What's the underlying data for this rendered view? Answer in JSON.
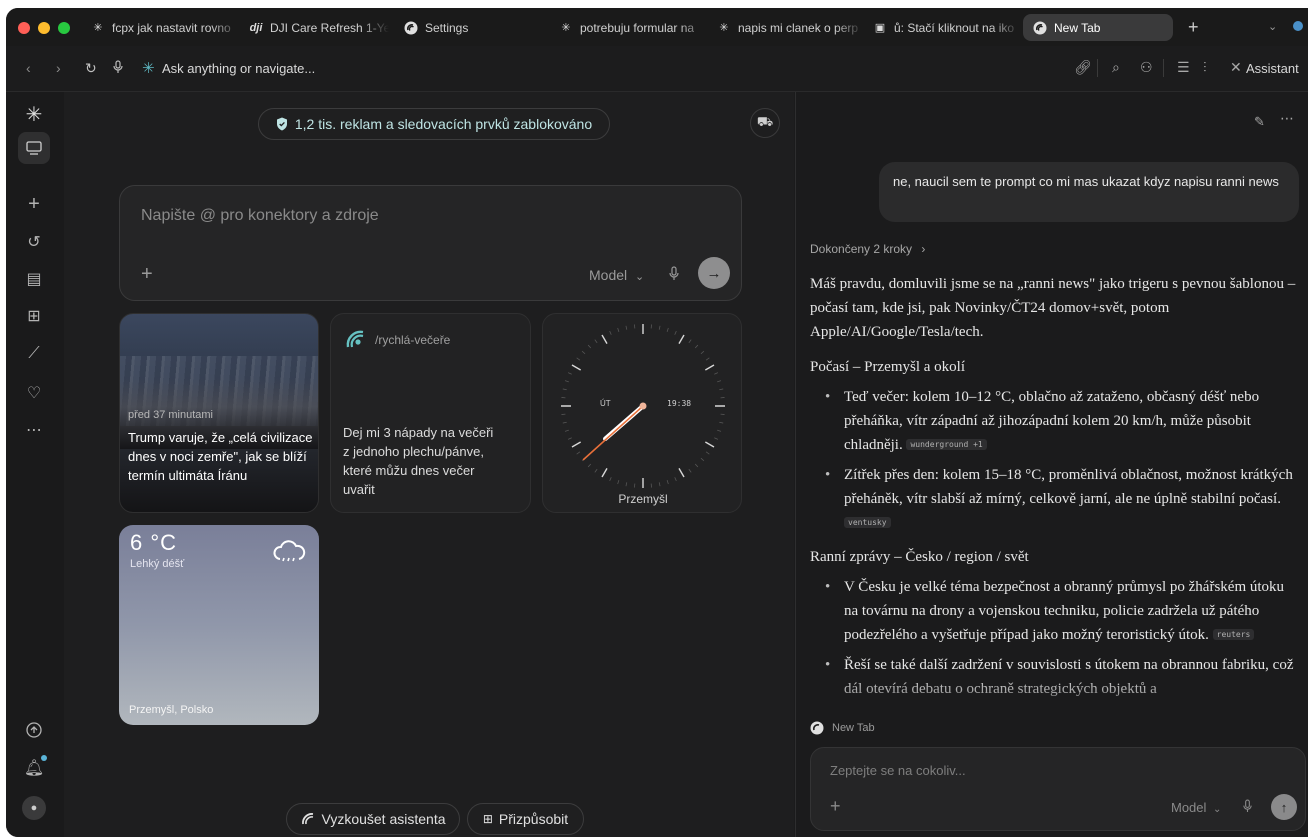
{
  "tabs": [
    {
      "label": "fcpx jak nastavit rovno",
      "icon": "perplexity-icon"
    },
    {
      "label": "DJI Care Refresh 1-Yea",
      "icon": "dji-icon"
    },
    {
      "label": "Settings",
      "icon": "comet-icon"
    },
    {
      "label": "potrebuju formular na",
      "icon": "perplexity-icon"
    },
    {
      "label": "napis mi clanek o perp",
      "icon": "perplexity-icon"
    },
    {
      "label": "ů: Stačí kliknout na iko",
      "icon": "window-icon"
    },
    {
      "label": "New Tab",
      "icon": "comet-icon"
    }
  ],
  "address": {
    "placeholder": "Ask anything or navigate..."
  },
  "toolbar": {
    "assistant_label": "Assistant"
  },
  "main": {
    "tracker_pill": "1,2 tis. reklam a sledovacích prvků zablokováno",
    "composer": {
      "placeholder": "Napište @ pro konektory a zdroje",
      "model_label": "Model"
    },
    "news_card": {
      "time": "před 37 minutami",
      "headline": "Trump varuje, že „celá civilizace dnes v noci zemře\", jak se blíží termín ultimáta Íránu"
    },
    "shortcut_card": {
      "name": "/rychlá-večeře",
      "prompt": "Dej mi 3 nápady na večeři z jednoho plechu/pánve, které můžu dnes večer uvařit"
    },
    "clock_card": {
      "day": "ÚT",
      "digital": "19:38",
      "city": "Przemyšl"
    },
    "weather_card": {
      "temp": "6 °C",
      "condition": "Lehký déšť",
      "location": "Przemyšl, Polsko"
    },
    "bottom": {
      "try_assistant": "Vyzkoušet asistenta",
      "customize": "Přizpůsobit"
    }
  },
  "panel": {
    "user_message": "ne, naucil sem te prompt co mi mas ukazat kdyz napisu ranni news",
    "steps_label": "Dokončeny 2 kroky",
    "intro": "Máš pravdu, domluvili jsme se na „ranni news\" jako trigeru s pevnou šablonou – počasí tam, kde jsi, pak Novinky/ČT24 domov+svět, potom Apple/AI/Google/Tesla/tech.",
    "weather_heading": "Počasí – Przemyšl a okolí",
    "weather_items": [
      {
        "text": "Teď večer: kolem 10–12 °C, oblačno až zataženo, občasný déšť nebo přeháňka, vítr západní až jihozápadní kolem 20 km/h, může působit chladněji.",
        "source": "wunderground +1"
      },
      {
        "text": "Zítřek přes den: kolem 15–18 °C, proměnlivá oblačnost, možnost krátkých přeháněk, vítr slabší až mírný, celkově jarní, ale ne úplně stabilní počasí.",
        "source": "ventusky"
      }
    ],
    "news_heading": "Ranní zprávy – Česko / region / svět",
    "news_items": [
      {
        "text": "V Česku je velké téma bezpečnost a obranný průmysl po žhářském útoku na továrnu na drony a vojenskou techniku, policie zadržela už pátého podezřelého a vyšetřuje případ jako možný teroristický útok.",
        "source": "reuters"
      },
      {
        "text": "Řeší se také další zadržení v souvislosti s útokem na obrannou fabriku, což dál otevírá debatu o ochraně strategických objektů a",
        "source": ""
      }
    ],
    "context_tab": "New Tab",
    "composer_placeholder": "Zeptejte se na cokoliv...",
    "model_label": "Model"
  },
  "colors": {
    "accent_teal": "#66c2c2",
    "clock_hand": "#e8703a",
    "weather_top": "#7a7f99",
    "weather_bottom": "#b1b7bd"
  }
}
